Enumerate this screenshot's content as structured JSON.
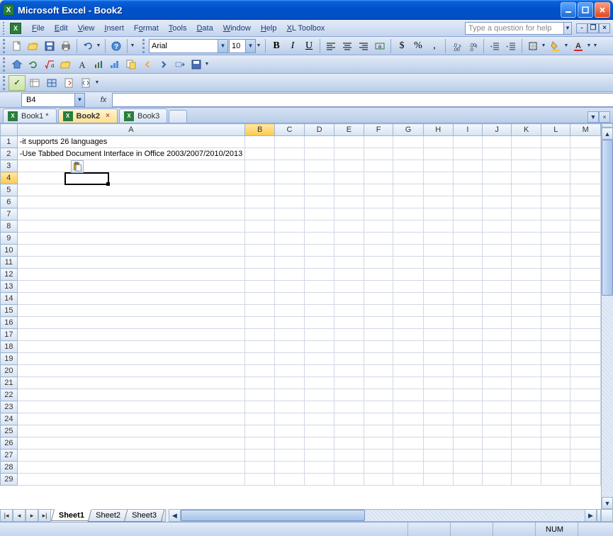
{
  "titlebar": {
    "title": "Microsoft Excel - Book2"
  },
  "menu": {
    "items": [
      "File",
      "Edit",
      "View",
      "Insert",
      "Format",
      "Tools",
      "Data",
      "Window",
      "Help",
      "XL Toolbox"
    ],
    "help_placeholder": "Type a question for help"
  },
  "toolbar1": {
    "font_name": "Arial",
    "font_size": "10",
    "bold": "B",
    "italic": "I",
    "underline": "U",
    "currency": "$",
    "percent": "%",
    "comma": ","
  },
  "namebox": {
    "ref": "B4"
  },
  "formula": {
    "fx": "fx"
  },
  "wbtabs": [
    {
      "label": "Book1 *",
      "active": false
    },
    {
      "label": "Book2",
      "active": true
    },
    {
      "label": "Book3",
      "active": false
    }
  ],
  "columns": [
    "A",
    "B",
    "C",
    "D",
    "E",
    "F",
    "G",
    "H",
    "I",
    "J",
    "K",
    "L",
    "M"
  ],
  "rows": 29,
  "active_col": "B",
  "active_row": 4,
  "cells": {
    "A1": "-it supports 26 languages",
    "A2": "-Use Tabbed Document Interface in Office 2003/2007/2010/2013"
  },
  "sheettabs": [
    "Sheet1",
    "Sheet2",
    "Sheet3"
  ],
  "active_sheet": "Sheet1",
  "status": {
    "num": "NUM"
  }
}
